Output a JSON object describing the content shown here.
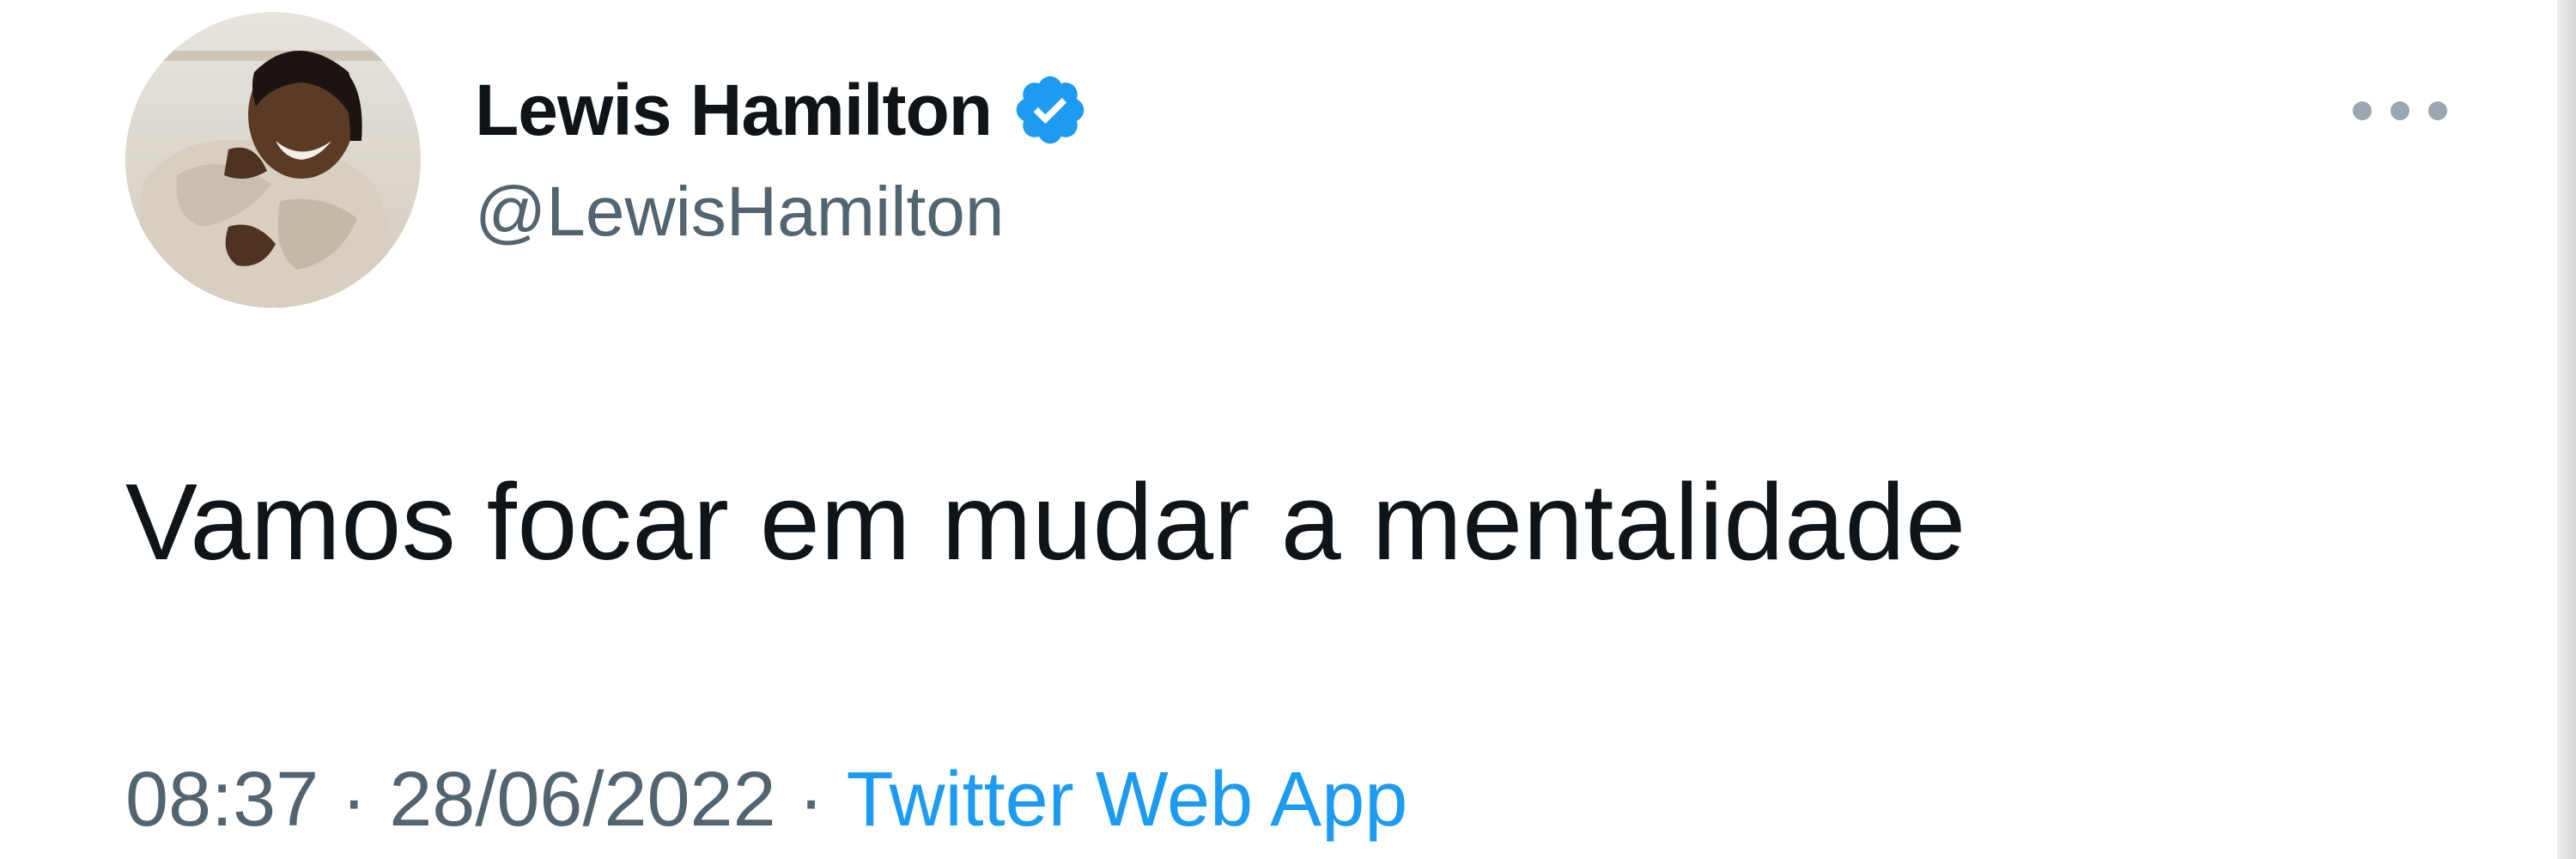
{
  "author": {
    "display_name": "Lewis Hamilton",
    "handle": "@LewisHamilton",
    "verified": true,
    "avatar": "profile-photo"
  },
  "tweet": {
    "text": "Vamos focar em mudar a mentalidade",
    "time": "08:37",
    "date": "28/06/2022",
    "separator": "·",
    "source": "Twitter Web App"
  },
  "icons": {
    "verified": "verified-badge-icon",
    "more": "more-options-icon"
  },
  "colors": {
    "text_primary": "#0f1419",
    "text_secondary": "#536471",
    "link": "#1d9bf0",
    "verified_badge": "#1d9bf0"
  }
}
